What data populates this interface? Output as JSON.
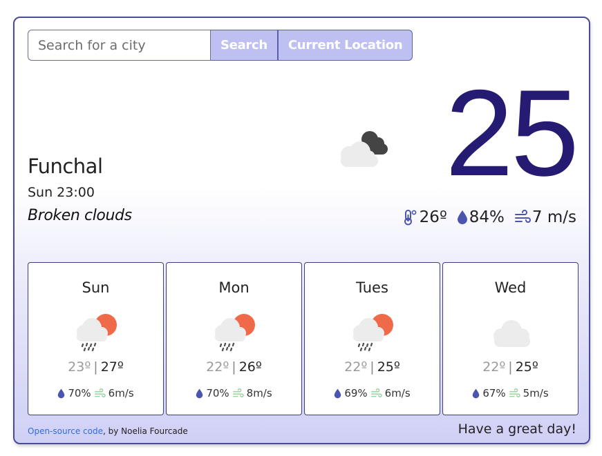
{
  "search": {
    "placeholder": "Search for a city",
    "value": "",
    "search_label": "Search",
    "location_label": "Current Location"
  },
  "current": {
    "city": "Funchal",
    "datetime": "Sun 23:00",
    "description": "Broken clouds",
    "temperature": "25",
    "icon": "broken-clouds-icon",
    "feels_like": "26º",
    "humidity": "84%",
    "wind": "7 m/s"
  },
  "forecast": [
    {
      "day": "Sun",
      "icon": "rain-sun-icon",
      "min": "23º",
      "max": "27º",
      "humidity": "70%",
      "wind": "6m/s"
    },
    {
      "day": "Mon",
      "icon": "rain-sun-icon",
      "min": "22º",
      "max": "26º",
      "humidity": "70%",
      "wind": "8m/s"
    },
    {
      "day": "Tues",
      "icon": "rain-sun-icon",
      "min": "22º",
      "max": "25º",
      "humidity": "69%",
      "wind": "6m/s"
    },
    {
      "day": "Wed",
      "icon": "cloud-icon",
      "min": "22º",
      "max": "25º",
      "humidity": "67%",
      "wind": "5m/s"
    }
  ],
  "footer": {
    "link_text": "Open-source code",
    "credit": ", by Noelia Fourcade",
    "message": "Have a great day!"
  },
  "colors": {
    "accent": "#261b72",
    "button_bg": "#bfc0f2",
    "border": "#4a4a98",
    "link": "#2f6ee0",
    "sun": "#ef6a4a",
    "drop": "#4b55b0",
    "wind": "#9ad3a4"
  }
}
